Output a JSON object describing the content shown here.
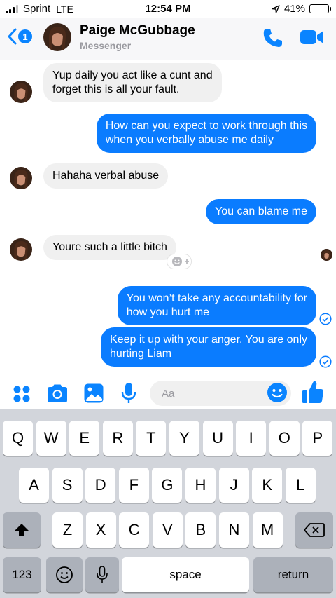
{
  "status": {
    "carrier": "Sprint",
    "network": "LTE",
    "time": "12:54 PM",
    "battery": "41%",
    "battery_level": 0.41
  },
  "header": {
    "unread_count": "1",
    "contact_name": "Paige McGubbage",
    "subtitle": "Messenger"
  },
  "messages": [
    {
      "side": "in",
      "lines": [
        "Yup daily you act like a cunt and",
        "forget this is all your fault."
      ]
    },
    {
      "side": "out",
      "lines": [
        "How can you expect to work through this",
        "when you verbally abuse me daily"
      ]
    },
    {
      "side": "in",
      "lines": [
        "Hahaha verbal abuse"
      ]
    },
    {
      "side": "out",
      "lines": [
        "You can blame me"
      ]
    },
    {
      "side": "in",
      "lines": [
        "Youre such a little bitch"
      ]
    },
    {
      "side": "out",
      "lines": [
        "You won’t take any accountability for",
        "how you hurt me"
      ]
    },
    {
      "side": "out",
      "lines": [
        "Keep it up with your anger. You are only",
        "hurting Liam"
      ]
    }
  ],
  "composer": {
    "placeholder": "Aa"
  },
  "keyboard": {
    "row1": [
      "Q",
      "W",
      "E",
      "R",
      "T",
      "Y",
      "U",
      "I",
      "O",
      "P"
    ],
    "row2": [
      "A",
      "S",
      "D",
      "F",
      "G",
      "H",
      "J",
      "K",
      "L"
    ],
    "row3": [
      "Z",
      "X",
      "C",
      "V",
      "B",
      "N",
      "M"
    ],
    "numbers_label": "123",
    "space_label": "space",
    "return_label": "return"
  },
  "colors": {
    "accent": "#0a7cff",
    "incoming_bubble": "#f0f0f0",
    "keyboard_bg": "#d2d5db"
  }
}
